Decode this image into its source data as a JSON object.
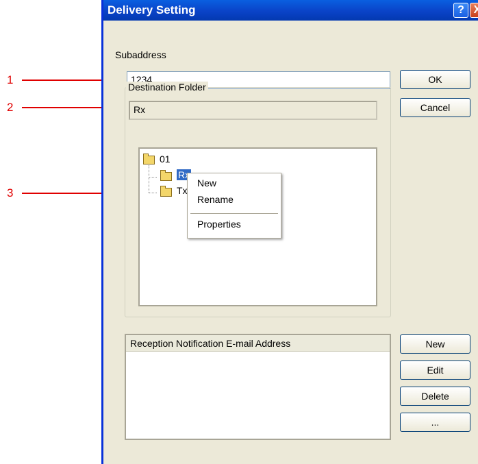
{
  "callouts": [
    {
      "num": "1"
    },
    {
      "num": "2"
    },
    {
      "num": "3"
    }
  ],
  "dialog": {
    "title": "Delivery Setting",
    "help_icon": "?",
    "close_icon": "X",
    "subaddress_label": "Subaddress",
    "subaddress_value": "1234",
    "ok_label": "OK",
    "cancel_label": "Cancel",
    "destination_group_label": "Destination Folder",
    "destination_value": "Rx",
    "tree": {
      "root": "01",
      "child1": "Rx",
      "child2": "Tx"
    },
    "context_menu": {
      "new": "New",
      "rename": "Rename",
      "properties": "Properties"
    },
    "notification_header": "Reception Notification E-mail Address",
    "new_label": "New",
    "edit_label": "Edit",
    "delete_label": "Delete",
    "more_label": "..."
  }
}
